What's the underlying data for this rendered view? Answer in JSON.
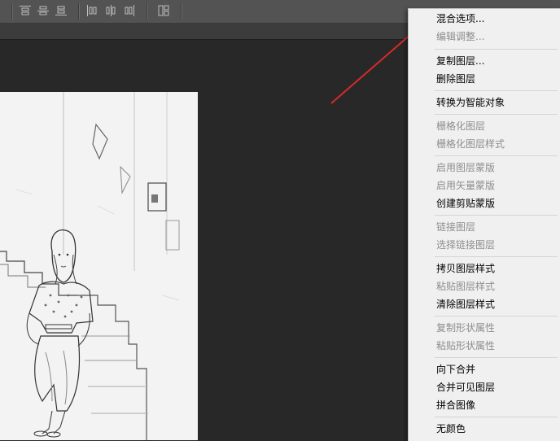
{
  "menu": {
    "items": [
      {
        "label": "混合选项...",
        "enabled": true
      },
      {
        "label": "编辑调整...",
        "enabled": false
      },
      {
        "label": "复制图层...",
        "enabled": true
      },
      {
        "label": "删除图层",
        "enabled": true
      },
      {
        "label": "转换为智能对象",
        "enabled": true
      },
      {
        "label": "栅格化图层",
        "enabled": false
      },
      {
        "label": "栅格化图层样式",
        "enabled": false
      },
      {
        "label": "启用图层蒙版",
        "enabled": false
      },
      {
        "label": "启用矢量蒙版",
        "enabled": false
      },
      {
        "label": "创建剪贴蒙版",
        "enabled": true
      },
      {
        "label": "链接图层",
        "enabled": false
      },
      {
        "label": "选择链接图层",
        "enabled": false
      },
      {
        "label": "拷贝图层样式",
        "enabled": true
      },
      {
        "label": "粘贴图层样式",
        "enabled": false
      },
      {
        "label": "清除图层样式",
        "enabled": true
      },
      {
        "label": "复制形状属性",
        "enabled": false
      },
      {
        "label": "粘贴形状属性",
        "enabled": false
      },
      {
        "label": "向下合并",
        "enabled": true
      },
      {
        "label": "合并可见图层",
        "enabled": true
      },
      {
        "label": "拼合图像",
        "enabled": true
      },
      {
        "label": "无颜色",
        "enabled": true
      }
    ]
  },
  "toolbar": {
    "icons": [
      "align-top-edges-icon",
      "align-vertical-centers-icon",
      "align-bottom-edges-icon",
      "align-left-edges-icon",
      "align-horizontal-centers-icon",
      "align-right-edges-icon",
      "distribute-icon"
    ]
  },
  "colors": {
    "workspace": "#282828",
    "toolbar": "#535353",
    "menu_bg": "#f0f0f0",
    "arrow": "#d62a2a",
    "disabled_text": "#8d8d8d"
  }
}
